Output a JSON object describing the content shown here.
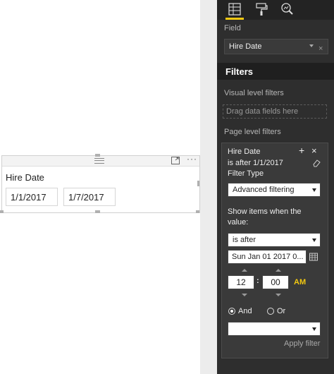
{
  "canvas": {
    "slicer": {
      "title": "Hire Date",
      "start_date": "1/1/2017",
      "end_date": "1/7/2017",
      "more_label": "···"
    }
  },
  "panel": {
    "toolbar": {
      "icons": [
        "fields-icon",
        "format-paint-roller-icon",
        "analytics-magnifier-icon"
      ],
      "active_color": "#f2c811"
    },
    "field": {
      "label": "Field",
      "value": "Hire Date"
    },
    "filters": {
      "title": "Filters",
      "visual_level_label": "Visual level filters",
      "drag_placeholder": "Drag data fields here",
      "page_level_label": "Page level filters"
    },
    "filter_card": {
      "field_name": "Hire Date",
      "summary": "is after 1/1/2017",
      "filter_type_label": "Filter Type",
      "filter_type_value": "Advanced filtering",
      "show_items_label": "Show items when the",
      "show_items_label2": "value:",
      "condition_value": "is after",
      "date_value": "Sun Jan 01 2017 0...",
      "hour": "12",
      "minute": "00",
      "ampm": "AM",
      "ampm_color": "#f2c811",
      "and_label": "And",
      "or_label": "Or",
      "and_selected": true,
      "apply_label": "Apply filter"
    }
  }
}
